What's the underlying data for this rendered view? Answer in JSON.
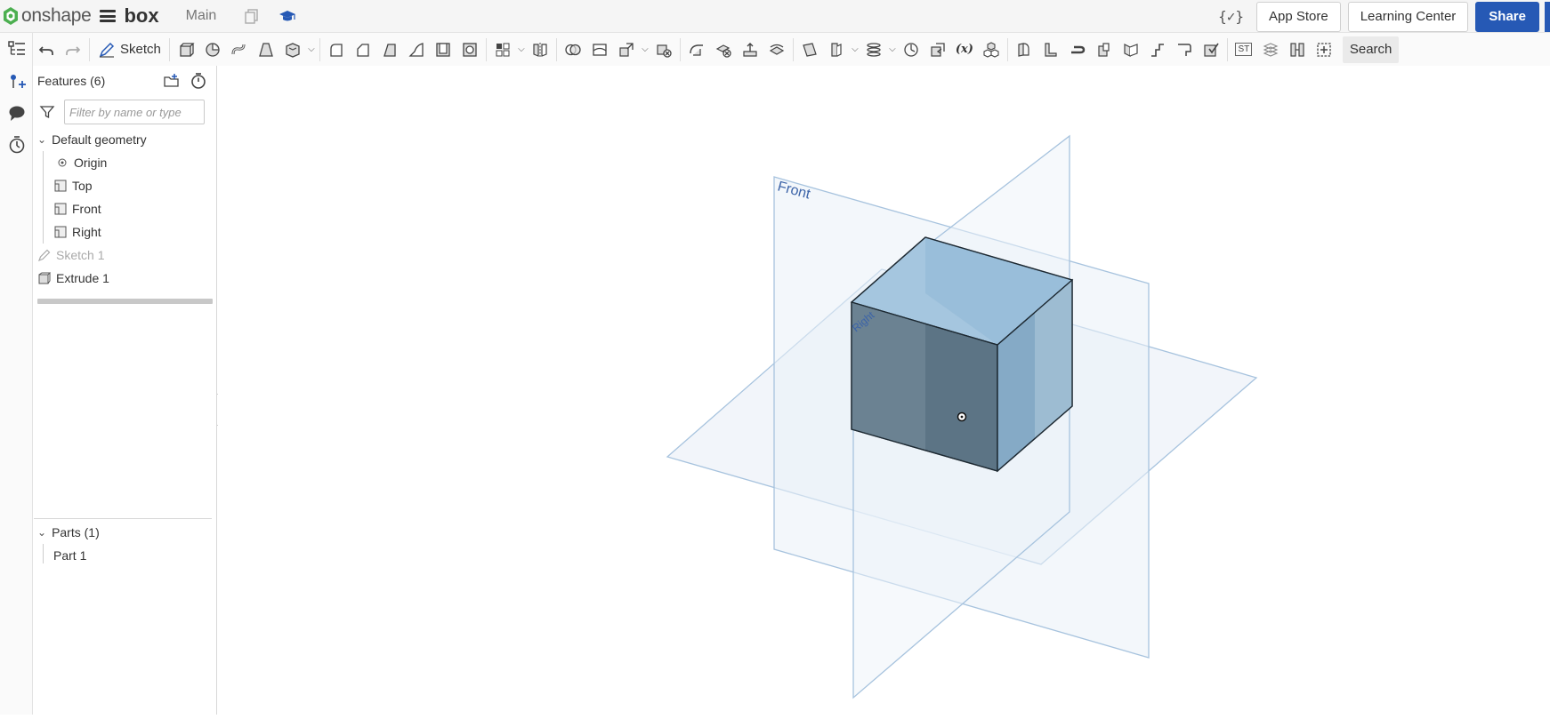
{
  "header": {
    "logo_text": "onshape",
    "doc_name": "box",
    "workspace": "Main",
    "variables_label": "{✓}",
    "app_store": "App Store",
    "learning_center": "Learning Center",
    "share": "Share"
  },
  "toolbar": {
    "sketch_label": "Sketch",
    "st_label": "ST",
    "fx_label": "(x)",
    "search_label": "Search"
  },
  "panel": {
    "features_title": "Features (6)",
    "filter_placeholder": "Filter by name or type",
    "default_geometry": "Default geometry",
    "items": {
      "origin": "Origin",
      "top": "Top",
      "front": "Front",
      "right": "Right",
      "sketch1": "Sketch 1",
      "extrude1": "Extrude 1"
    },
    "parts_title": "Parts (1)",
    "part1": "Part 1"
  },
  "viewport": {
    "front_plane_label": "Front",
    "right_plane_label": "Right"
  },
  "colors": {
    "accent": "#2659b5",
    "plane_stroke": "#a7c3de",
    "plane_fill": "#e8eff7",
    "box_top": "#a5c6df",
    "box_front": "#5c7485",
    "box_side": "#85aac6"
  }
}
